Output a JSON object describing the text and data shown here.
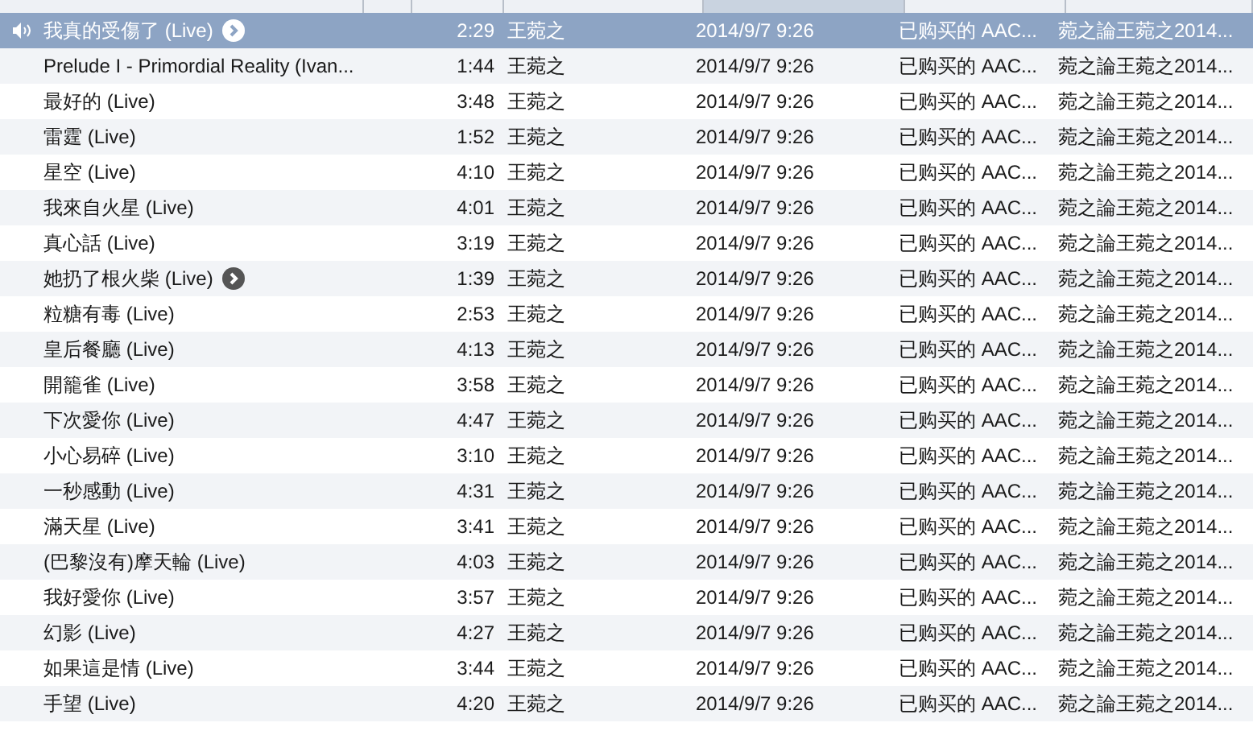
{
  "header": {
    "columns": [
      {
        "sorted": false
      },
      {
        "sorted": false
      },
      {
        "sorted": false
      },
      {
        "sorted": false
      },
      {
        "sorted": true
      },
      {
        "sorted": false
      },
      {
        "sorted": false
      }
    ]
  },
  "rows": [
    {
      "playing": true,
      "selected": true,
      "arrow": true,
      "name": "我真的受傷了 (Live)",
      "time": "2:29",
      "artist": "王菀之",
      "date": "2014/9/7 9:26",
      "kind": "已购买的 AAC...",
      "album": "菀之論王菀之2014..."
    },
    {
      "playing": false,
      "selected": false,
      "arrow": false,
      "name": "Prelude I - Primordial Reality (Ivan...",
      "time": "1:44",
      "artist": "王菀之",
      "date": "2014/9/7 9:26",
      "kind": "已购买的 AAC...",
      "album": "菀之論王菀之2014..."
    },
    {
      "playing": false,
      "selected": false,
      "arrow": false,
      "name": "最好的 (Live)",
      "time": "3:48",
      "artist": "王菀之",
      "date": "2014/9/7 9:26",
      "kind": "已购买的 AAC...",
      "album": "菀之論王菀之2014..."
    },
    {
      "playing": false,
      "selected": false,
      "arrow": false,
      "name": "雷霆 (Live)",
      "time": "1:52",
      "artist": "王菀之",
      "date": "2014/9/7 9:26",
      "kind": "已购买的 AAC...",
      "album": "菀之論王菀之2014..."
    },
    {
      "playing": false,
      "selected": false,
      "arrow": false,
      "name": "星空 (Live)",
      "time": "4:10",
      "artist": "王菀之",
      "date": "2014/9/7 9:26",
      "kind": "已购买的 AAC...",
      "album": "菀之論王菀之2014..."
    },
    {
      "playing": false,
      "selected": false,
      "arrow": false,
      "name": "我來自火星 (Live)",
      "time": "4:01",
      "artist": "王菀之",
      "date": "2014/9/7 9:26",
      "kind": "已购买的 AAC...",
      "album": "菀之論王菀之2014..."
    },
    {
      "playing": false,
      "selected": false,
      "arrow": false,
      "name": "真心話 (Live)",
      "time": "3:19",
      "artist": "王菀之",
      "date": "2014/9/7 9:26",
      "kind": "已购买的 AAC...",
      "album": "菀之論王菀之2014..."
    },
    {
      "playing": false,
      "selected": false,
      "arrow": true,
      "name": "她扔了根火柴 (Live)",
      "time": "1:39",
      "artist": "王菀之",
      "date": "2014/9/7 9:26",
      "kind": "已购买的 AAC...",
      "album": "菀之論王菀之2014..."
    },
    {
      "playing": false,
      "selected": false,
      "arrow": false,
      "name": "粒糖有毒 (Live)",
      "time": "2:53",
      "artist": "王菀之",
      "date": "2014/9/7 9:26",
      "kind": "已购买的 AAC...",
      "album": "菀之論王菀之2014..."
    },
    {
      "playing": false,
      "selected": false,
      "arrow": false,
      "name": "皇后餐廳 (Live)",
      "time": "4:13",
      "artist": "王菀之",
      "date": "2014/9/7 9:26",
      "kind": "已购买的 AAC...",
      "album": "菀之論王菀之2014..."
    },
    {
      "playing": false,
      "selected": false,
      "arrow": false,
      "name": "開籠雀 (Live)",
      "time": "3:58",
      "artist": "王菀之",
      "date": "2014/9/7 9:26",
      "kind": "已购买的 AAC...",
      "album": "菀之論王菀之2014..."
    },
    {
      "playing": false,
      "selected": false,
      "arrow": false,
      "name": "下次愛你 (Live)",
      "time": "4:47",
      "artist": "王菀之",
      "date": "2014/9/7 9:26",
      "kind": "已购买的 AAC...",
      "album": "菀之論王菀之2014..."
    },
    {
      "playing": false,
      "selected": false,
      "arrow": false,
      "name": "小心易碎 (Live)",
      "time": "3:10",
      "artist": "王菀之",
      "date": "2014/9/7 9:26",
      "kind": "已购买的 AAC...",
      "album": "菀之論王菀之2014..."
    },
    {
      "playing": false,
      "selected": false,
      "arrow": false,
      "name": "一秒感動 (Live)",
      "time": "4:31",
      "artist": "王菀之",
      "date": "2014/9/7 9:26",
      "kind": "已购买的 AAC...",
      "album": "菀之論王菀之2014..."
    },
    {
      "playing": false,
      "selected": false,
      "arrow": false,
      "name": "滿天星 (Live)",
      "time": "3:41",
      "artist": "王菀之",
      "date": "2014/9/7 9:26",
      "kind": "已购买的 AAC...",
      "album": "菀之論王菀之2014..."
    },
    {
      "playing": false,
      "selected": false,
      "arrow": false,
      "name": "(巴黎沒有)摩天輪 (Live)",
      "time": "4:03",
      "artist": "王菀之",
      "date": "2014/9/7 9:26",
      "kind": "已购买的 AAC...",
      "album": "菀之論王菀之2014..."
    },
    {
      "playing": false,
      "selected": false,
      "arrow": false,
      "name": "我好愛你 (Live)",
      "time": "3:57",
      "artist": "王菀之",
      "date": "2014/9/7 9:26",
      "kind": "已购买的 AAC...",
      "album": "菀之論王菀之2014..."
    },
    {
      "playing": false,
      "selected": false,
      "arrow": false,
      "name": "幻影 (Live)",
      "time": "4:27",
      "artist": "王菀之",
      "date": "2014/9/7 9:26",
      "kind": "已购买的 AAC...",
      "album": "菀之論王菀之2014..."
    },
    {
      "playing": false,
      "selected": false,
      "arrow": false,
      "name": "如果這是情 (Live)",
      "time": "3:44",
      "artist": "王菀之",
      "date": "2014/9/7 9:26",
      "kind": "已购买的 AAC...",
      "album": "菀之論王菀之2014..."
    },
    {
      "playing": false,
      "selected": false,
      "arrow": false,
      "name": "手望 (Live)",
      "time": "4:20",
      "artist": "王菀之",
      "date": "2014/9/7 9:26",
      "kind": "已购买的 AAC...",
      "album": "菀之論王菀之2014..."
    }
  ]
}
